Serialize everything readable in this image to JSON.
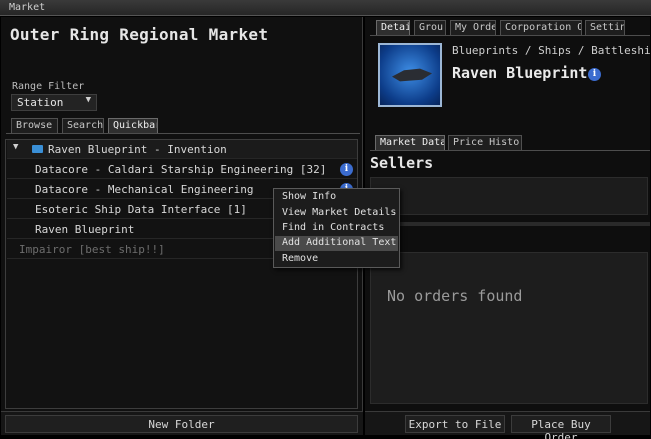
{
  "window": {
    "title": "Market"
  },
  "left": {
    "market_name": "Outer Ring Regional Market",
    "range_filter": {
      "label": "Range Filter",
      "value": "Station"
    },
    "tabs": [
      {
        "label": "Browse",
        "active": false
      },
      {
        "label": "Search",
        "active": false
      },
      {
        "label": "Quickbar",
        "active": true
      }
    ],
    "tree": {
      "group": "Raven Blueprint - Invention",
      "items": [
        {
          "label": "Datacore - Caldari Starship Engineering [32]",
          "info": true
        },
        {
          "label": "Datacore - Mechanical Engineering",
          "info": true
        },
        {
          "label": "Esoteric Ship Data Interface [1]",
          "info": false
        },
        {
          "label": "Raven Blueprint",
          "info": false
        },
        {
          "label": "Impairor [best ship!!]",
          "info": false
        }
      ]
    },
    "footer_button": "New Folder"
  },
  "right": {
    "tabs": [
      "Detai",
      "Grou",
      "My Orde",
      "Corporation Or",
      "Settin"
    ],
    "breadcrumb": "Blueprints / Ships / Battleships / Ca",
    "item_title": "Raven Blueprint",
    "data_tabs": [
      "Market Data",
      "Price History"
    ],
    "sellers_heading": "Sellers",
    "buyers_heading": "ers",
    "no_orders": "No orders found",
    "buttons": {
      "export": "Export to File",
      "buy": "Place Buy Order"
    }
  },
  "context_menu": {
    "items": [
      "Show Info",
      "View Market Details",
      "Find in Contracts",
      "Add Additional Text",
      "Remove"
    ],
    "highlighted": "Add Additional Text"
  },
  "colors": {
    "info_icon": "#3b6ccf",
    "folder_icon": "#3a8fd6",
    "menu_highlight": "#4a4a4a"
  }
}
